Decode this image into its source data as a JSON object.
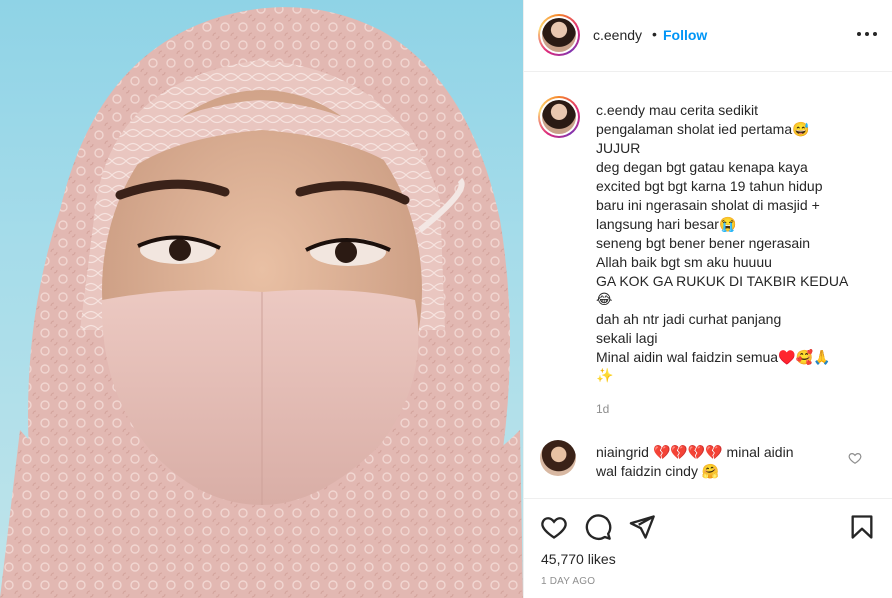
{
  "post": {
    "username": "c.eendy",
    "dot": "•",
    "follow_label": "Follow",
    "more_icon": "more-horizontal-icon"
  },
  "caption": {
    "username": "c.eendy",
    "lines": [
      "mau cerita sedikit",
      "pengalaman sholat ied pertama😅",
      "JUJUR",
      "deg degan bgt gatau kenapa kaya",
      "excited bgt bgt karna 19 tahun hidup",
      "baru ini ngerasain sholat di masjid +",
      "langsung hari besar😭",
      "seneng bgt bener bener ngerasain",
      "Allah baik bgt sm aku huuuu",
      "GA KOK GA RUKUK DI TAKBIR KEDUA",
      "😂",
      "dah ah ntr jadi curhat panjang",
      "sekali lagi",
      "Minal aidin wal faidzin semua♥️🥰🙏",
      "✨"
    ],
    "age": "1d"
  },
  "comment": {
    "username": "niaingrid",
    "text_line1": "💔💔💔💔 minal aidin",
    "text_line2": "wal faidzin cindy 🤗"
  },
  "actions": {
    "like_icon": "heart-icon",
    "comment_icon": "comment-icon",
    "share_icon": "share-icon",
    "save_icon": "bookmark-icon",
    "likes": "45,770 likes",
    "date": "1 DAY AGO"
  },
  "colors": {
    "accent": "#0095f6",
    "text": "#262626",
    "muted": "#8e8e8e",
    "sky": "#a5dcea",
    "veil": "#e4bcb6",
    "mask": "#e8c3bd"
  }
}
